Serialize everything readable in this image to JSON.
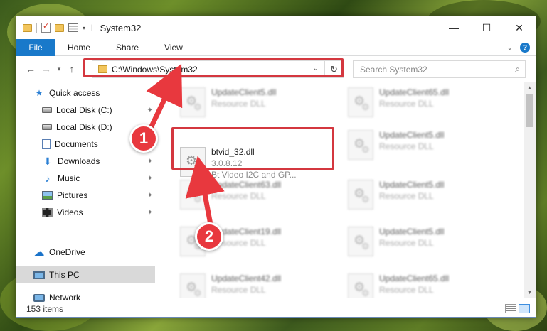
{
  "window": {
    "title": "System32",
    "controls": {
      "minimize": "—",
      "maximize": "☐",
      "close": "✕"
    }
  },
  "ribbon": {
    "tabs": [
      {
        "label": "File"
      },
      {
        "label": "Home"
      },
      {
        "label": "Share"
      },
      {
        "label": "View"
      }
    ]
  },
  "navbar": {
    "address": "C:\\Windows\\System32",
    "search_placeholder": "Search System32"
  },
  "sidebar": {
    "items": [
      {
        "label": "Quick access",
        "icon": "star-icon"
      },
      {
        "label": "Local Disk (C:)",
        "icon": "drive-icon",
        "pinned": true
      },
      {
        "label": "Local Disk (D:)",
        "icon": "drive-icon",
        "pinned": true
      },
      {
        "label": "Documents",
        "icon": "documents-icon",
        "pinned": true
      },
      {
        "label": "Downloads",
        "icon": "download-icon",
        "pinned": true
      },
      {
        "label": "Music",
        "icon": "music-icon",
        "pinned": true
      },
      {
        "label": "Pictures",
        "icon": "pictures-icon",
        "pinned": true
      },
      {
        "label": "Videos",
        "icon": "videos-icon",
        "pinned": true
      },
      {
        "label": "OneDrive",
        "icon": "cloud-icon"
      },
      {
        "label": "This PC",
        "icon": "pc-icon",
        "selected": true
      },
      {
        "label": "Network",
        "icon": "network-icon"
      }
    ]
  },
  "files": {
    "featured": {
      "name": "btvid_32.dll",
      "version": "3.0.8.12",
      "description": "Bt Video I2C and GP..."
    },
    "left_column": [
      {
        "name": "UpdateClient5.dll",
        "type": "Resource DLL"
      },
      {
        "name": "UpdateClient63.dll",
        "type": "Resource DLL"
      },
      {
        "name": "UpdateClient19.dll",
        "type": "Resource DLL"
      },
      {
        "name": "UpdateClient42.dll",
        "type": "Resource DLL"
      }
    ],
    "right_column": [
      {
        "name": "UpdateClient65.dll",
        "type": "Resource DLL"
      },
      {
        "name": "UpdateClient5.dll",
        "type": "Resource DLL"
      },
      {
        "name": "UpdateClient5.dll",
        "type": "Resource DLL"
      },
      {
        "name": "UpdateClient5.dll",
        "type": "Resource DLL"
      },
      {
        "name": "UpdateClient65.dll",
        "type": "Resource DLL"
      }
    ]
  },
  "status": {
    "item_count": "153 items"
  },
  "annotations": {
    "badge1": "1",
    "badge2": "2",
    "color": "#d4373f"
  }
}
